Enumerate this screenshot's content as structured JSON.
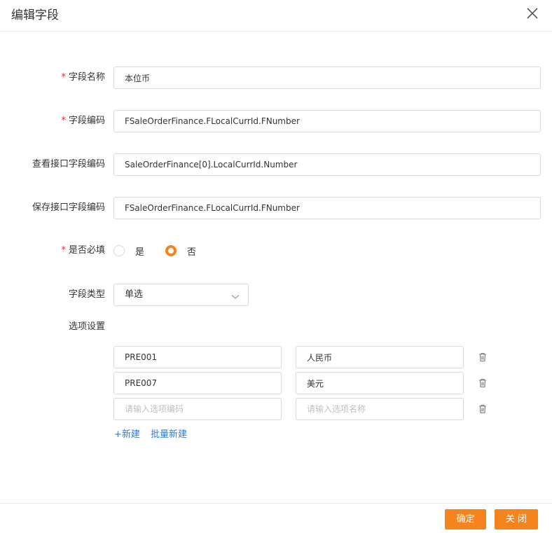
{
  "dialog": {
    "title": "编辑字段"
  },
  "form": {
    "field_name": {
      "label": "字段名称",
      "required": "*",
      "value": "本位币"
    },
    "field_code": {
      "label": "字段编码",
      "required": "*",
      "value": "FSaleOrderFinance.FLocalCurrId.FNumber"
    },
    "view_api_code": {
      "label": "查看接口字段编码",
      "value": "SaleOrderFinance[0].LocalCurrId.Number"
    },
    "save_api_code": {
      "label": "保存接口字段编码",
      "value": "FSaleOrderFinance.FLocalCurrId.FNumber"
    },
    "is_required": {
      "label": "是否必填",
      "required": "*",
      "options": [
        {
          "label": "是",
          "checked": false
        },
        {
          "label": "否",
          "checked": true
        }
      ]
    },
    "field_type": {
      "label": "字段类型",
      "value": "单选"
    },
    "options_setting": {
      "label": "选项设置",
      "rows": [
        {
          "code": "PRE001",
          "name": "人民币"
        },
        {
          "code": "PRE007",
          "name": "美元"
        },
        {
          "code": "",
          "name": "",
          "code_placeholder": "请输入选项编码",
          "name_placeholder": "请输入选项名称"
        }
      ],
      "add_link": "+新建",
      "batch_add_link": "批量新建"
    }
  },
  "footer": {
    "confirm_label": "确定",
    "close_label": "关 闭"
  },
  "colors": {
    "accent": "#f5841f",
    "link": "#2d7bd2",
    "required": "#f5222d",
    "border": "#d9d9d9"
  },
  "icons": {
    "close": "close-icon",
    "chevron": "chevron-down-icon",
    "trash": "trash-icon"
  }
}
